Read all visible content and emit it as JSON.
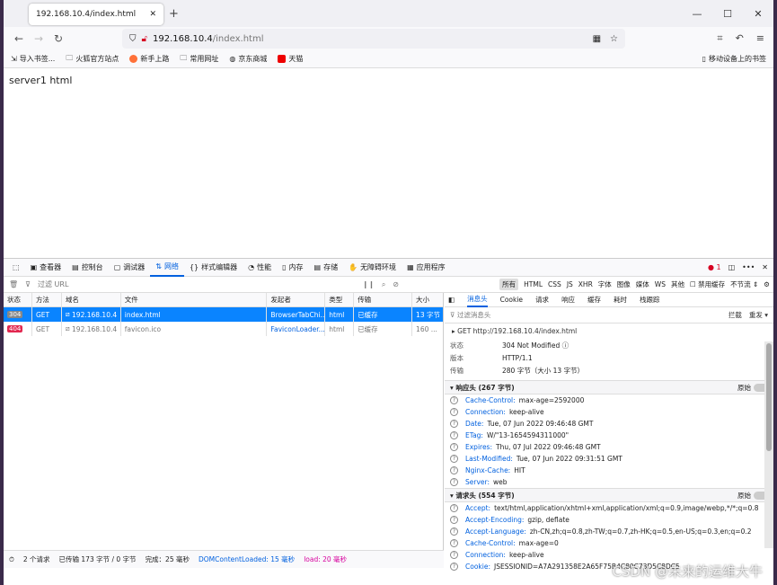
{
  "browser": {
    "tab_title": "192.168.10.4/index.html",
    "url_host": "192.168.10.4",
    "url_path": "/index.html"
  },
  "bookmarks": [
    "导入书签...",
    "火狐官方站点",
    "新手上路",
    "常用网址",
    "京东商城",
    "天猫"
  ],
  "bookmark_mobile": "移动设备上的书签",
  "page": {
    "text": "server1 html"
  },
  "devtools": {
    "tabs": [
      "查看器",
      "控制台",
      "调试器",
      "网络",
      "样式编辑器",
      "性能",
      "内存",
      "存储",
      "无障碍环境",
      "应用程序"
    ],
    "active_tab": "网络",
    "error_count": "1",
    "filter_placeholder": "过滤 URL",
    "type_filters": [
      "所有",
      "HTML",
      "CSS",
      "JS",
      "XHR",
      "字体",
      "图像",
      "媒体",
      "WS",
      "其他"
    ],
    "disable_cache": "禁用缓存",
    "throttle": "不节流",
    "columns": [
      "状态",
      "方法",
      "域名",
      "文件",
      "发起者",
      "类型",
      "传输",
      "大小"
    ],
    "rows": [
      {
        "status": "304",
        "method": "GET",
        "domain": "192.168.10.4",
        "file": "index.html",
        "initiator": "BrowserTabChi...",
        "type": "html",
        "transfer": "已缓存",
        "size": "13 字节"
      },
      {
        "status": "404",
        "method": "GET",
        "domain": "192.168.10.4",
        "file": "favicon.ico",
        "initiator": "FaviconLoader....",
        "type": "html",
        "transfer": "已缓存",
        "size": "160 ..."
      }
    ],
    "status": {
      "requests": "2 个请求",
      "transferred": "已传输 173 字节 / 0 字节",
      "finish": "完成：25 毫秒",
      "dcl": "DOMContentLoaded: 15 毫秒",
      "load": "load: 20 毫秒"
    },
    "detail_tabs": [
      "消息头",
      "Cookie",
      "请求",
      "响应",
      "缓存",
      "耗时",
      "栈跟踪"
    ],
    "detail_filter": "过滤消息头",
    "detail_block": "拦截",
    "detail_resend": "重发",
    "request_line": "GET  http://192.168.10.4/index.html",
    "summary": [
      {
        "k": "状态",
        "v": "304 Not Modified"
      },
      {
        "k": "版本",
        "v": "HTTP/1.1"
      },
      {
        "k": "传输",
        "v": "280 字节（大小 13 字节）"
      }
    ],
    "resp_title": "响应头 (267 字节)",
    "raw_label": "原始",
    "resp_headers": [
      {
        "n": "Cache-Control:",
        "v": "max-age=2592000"
      },
      {
        "n": "Connection:",
        "v": "keep-alive"
      },
      {
        "n": "Date:",
        "v": "Tue, 07 Jun 2022 09:46:48 GMT"
      },
      {
        "n": "ETag:",
        "v": "W/\"13-1654594311000\""
      },
      {
        "n": "Expires:",
        "v": "Thu, 07 Jul 2022 09:46:48 GMT"
      },
      {
        "n": "Last-Modified:",
        "v": "Tue, 07 Jun 2022 09:31:51 GMT"
      },
      {
        "n": "Nginx-Cache:",
        "v": "HIT"
      },
      {
        "n": "Server:",
        "v": "web"
      }
    ],
    "req_title": "请求头 (554 字节)",
    "req_headers": [
      {
        "n": "Accept:",
        "v": "text/html,application/xhtml+xml,application/xml;q=0.9,image/webp,*/*;q=0.8"
      },
      {
        "n": "Accept-Encoding:",
        "v": "gzip, deflate"
      },
      {
        "n": "Accept-Language:",
        "v": "zh-CN,zh;q=0.8,zh-TW;q=0.7,zh-HK;q=0.5,en-US;q=0.3,en;q=0.2"
      },
      {
        "n": "Cache-Control:",
        "v": "max-age=0"
      },
      {
        "n": "Connection:",
        "v": "keep-alive"
      },
      {
        "n": "Cookie:",
        "v": "JSESSIONID=A7A291358E2A65F75B4C80C73D5C8DC5"
      }
    ]
  },
  "watermark": "CSDN @未来的运维大牛",
  "colors": {
    "accent": "#0a84ff",
    "link": "#0060df",
    "error": "#d70022"
  }
}
